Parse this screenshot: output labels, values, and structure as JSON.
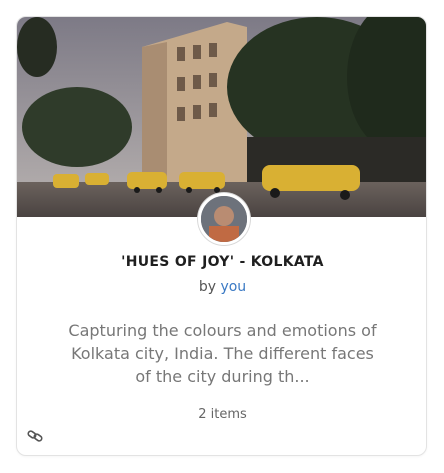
{
  "collection": {
    "title": "'HUES OF JOY' - KOLKATA",
    "by_prefix": "by",
    "author": "you",
    "description": "Capturing the colours and emotions of Kolkata city, India. The different faces of the city during th...",
    "item_count": "2 items",
    "cover_image_icon": "street-photo",
    "link_icon": "link-icon",
    "accent_color": "#3a79c4"
  }
}
